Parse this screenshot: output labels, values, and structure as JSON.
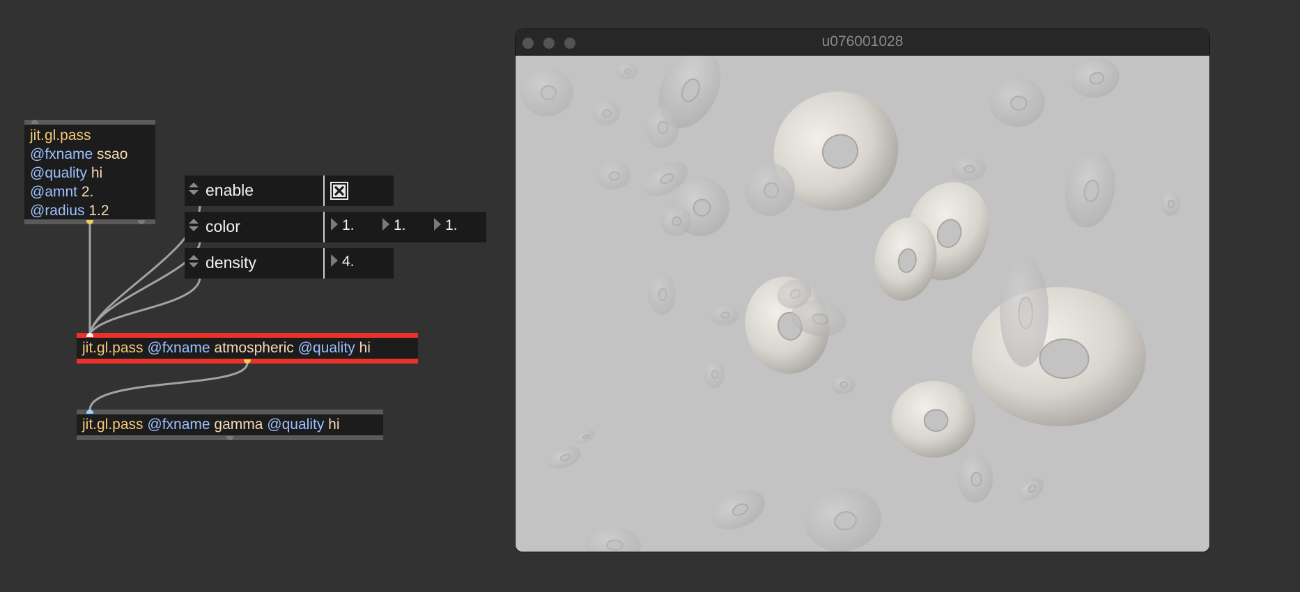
{
  "objects": {
    "ssao": {
      "lines": [
        [
          {
            "t": "jit.gl.pass",
            "c": "cls"
          }
        ],
        [
          {
            "t": "@fxname",
            "c": "attr"
          },
          {
            "t": " ssao",
            "c": "val"
          }
        ],
        [
          {
            "t": "@quality",
            "c": "attr"
          },
          {
            "t": " hi",
            "c": "val"
          }
        ],
        [
          {
            "t": "@amnt",
            "c": "attr"
          },
          {
            "t": " 2.",
            "c": "val"
          }
        ],
        [
          {
            "t": "@radius",
            "c": "attr"
          },
          {
            "t": " 1.2",
            "c": "val"
          }
        ]
      ]
    },
    "atmos": {
      "cls": "jit.gl.pass",
      "fxname_attr": "@fxname",
      "fxname_val": "atmospheric",
      "quality_attr": "@quality",
      "quality_val": "hi"
    },
    "gamma": {
      "cls": "jit.gl.pass",
      "fxname_attr": "@fxname",
      "fxname_val": "gamma",
      "quality_attr": "@quality",
      "quality_val": "hi"
    }
  },
  "params": {
    "enable": {
      "label": "enable",
      "checked": true
    },
    "color": {
      "label": "color",
      "values": [
        "1.",
        "1.",
        "1."
      ]
    },
    "density": {
      "label": "density",
      "value": "4."
    }
  },
  "window": {
    "title": "u076001028"
  },
  "icons": {
    "checkbox": "x-checkbox-icon",
    "stepper": "up-down-arrows-icon",
    "number_triangle": "triangle-right-icon"
  },
  "colors": {
    "background": "#323232",
    "object_bg": "#1c1c1c",
    "class_text": "#f5c878",
    "attr_text": "#9cc1ff",
    "value_text": "#f6d9b6",
    "selected_border": "#e8322a",
    "render_bg": "#c2c2c2"
  }
}
